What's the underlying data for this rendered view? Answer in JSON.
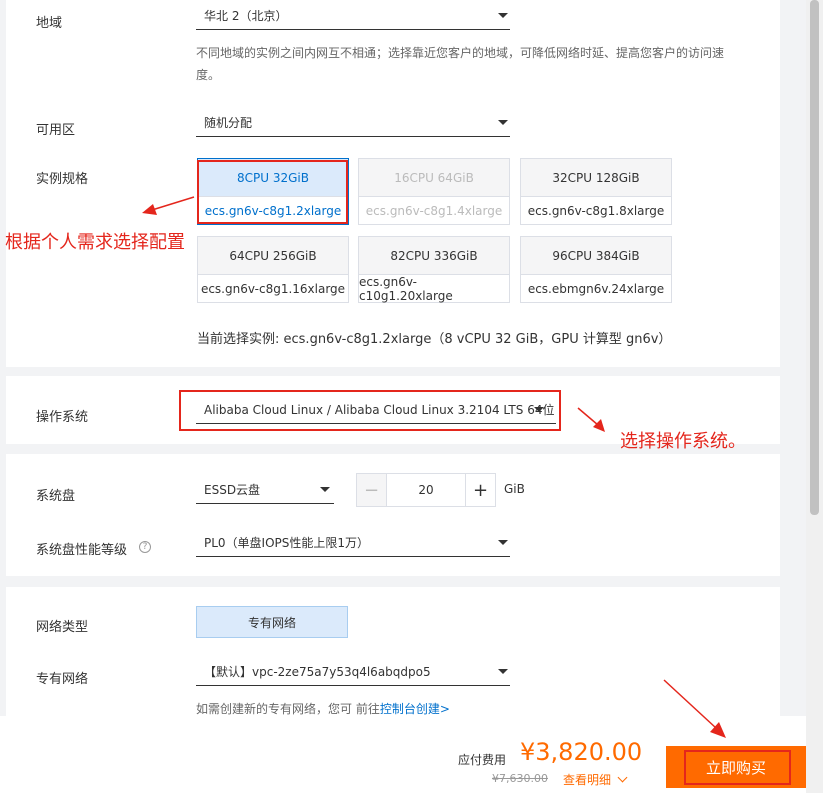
{
  "region": {
    "label": "地域",
    "value": "华北 2（北京）",
    "hint": "不同地域的实例之间内网互不相通；选择靠近您客户的地域，可降低网络时延、提高您客户的访问速度。"
  },
  "zone": {
    "label": "可用区",
    "value": "随机分配"
  },
  "spec": {
    "label": "实例规格",
    "annotation": "根据个人需求选择配置",
    "items": [
      {
        "top": "8CPU 32GiB",
        "bottom": "ecs.gn6v-c8g1.2xlarge",
        "state": "selected"
      },
      {
        "top": "16CPU 64GiB",
        "bottom": "ecs.gn6v-c8g1.4xlarge",
        "state": "disabled"
      },
      {
        "top": "32CPU 128GiB",
        "bottom": "ecs.gn6v-c8g1.8xlarge",
        "state": "normal"
      },
      {
        "top": "64CPU 256GiB",
        "bottom": "ecs.gn6v-c8g1.16xlarge",
        "state": "normal"
      },
      {
        "top": "82CPU 336GiB",
        "bottom": "ecs.gn6v-c10g1.20xlarge",
        "state": "normal"
      },
      {
        "top": "96CPU 384GiB",
        "bottom": "ecs.ebmgn6v.24xlarge",
        "state": "normal"
      }
    ],
    "current": "当前选择实例: ecs.gn6v-c8g1.2xlarge（8 vCPU 32 GiB，GPU 计算型 gn6v）"
  },
  "os": {
    "label": "操作系统",
    "value": "Alibaba Cloud Linux / Alibaba Cloud Linux 3.2104 LTS 64位",
    "annotation": "选择操作系统。"
  },
  "disk": {
    "label": "系统盘",
    "type": "ESSD云盘",
    "size": "20",
    "unit": "GiB",
    "minus": "−",
    "plus": "+",
    "perf_label": "系统盘性能等级",
    "perf_value": "PL0（单盘IOPS性能上限1万）"
  },
  "network": {
    "type_label": "网络类型",
    "type_value": "专有网络",
    "vpc_label": "专有网络",
    "vpc_value": "【默认】vpc-2ze75a7y53q4l6abqdpo5",
    "hint_prefix": "如需创建新的专有网络，您可 前往",
    "hint_link": "控制台创建>"
  },
  "footer": {
    "fee_label": "应付费用",
    "price": "¥3,820.00",
    "original": "¥7,630.00",
    "detail": "查看明细",
    "buy": "立即购买"
  },
  "colors": {
    "accent": "#ff6a00",
    "blue": "#0070cc",
    "red": "#e4261c"
  }
}
